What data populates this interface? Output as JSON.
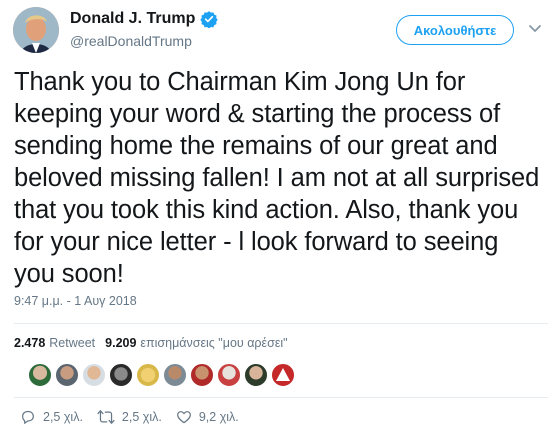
{
  "author": {
    "display_name": "Donald J. Trump",
    "handle": "@realDonaldTrump",
    "verified": true
  },
  "follow_button_label": "Ακολουθήστε",
  "tweet": {
    "text": "Thank you to Chairman Kim Jong Un for keeping your word & starting the process of sending home the remains of our great and beloved missing fallen! I am not at all surprised that you took this kind action. Also, thank you for your nice letter - l look forward to seeing you soon!",
    "timestamp": "9:47 μ.μ. - 1 Αυγ 2018"
  },
  "stats": {
    "retweets_count": "2.478",
    "retweets_label": "Retweet",
    "likes_count": "9.209",
    "likes_label": "επισημάνσεις \"μου αρέσει\""
  },
  "actions": {
    "reply_count": "2,5 χιλ.",
    "retweet_count": "2,5 χιλ.",
    "like_count": "9,2 χιλ."
  },
  "colors": {
    "accent": "#1da1f2",
    "secondary_text": "#657786"
  },
  "icons": [
    "verified-badge-icon",
    "chevron-down-icon",
    "reply-icon",
    "retweet-icon",
    "like-icon"
  ]
}
